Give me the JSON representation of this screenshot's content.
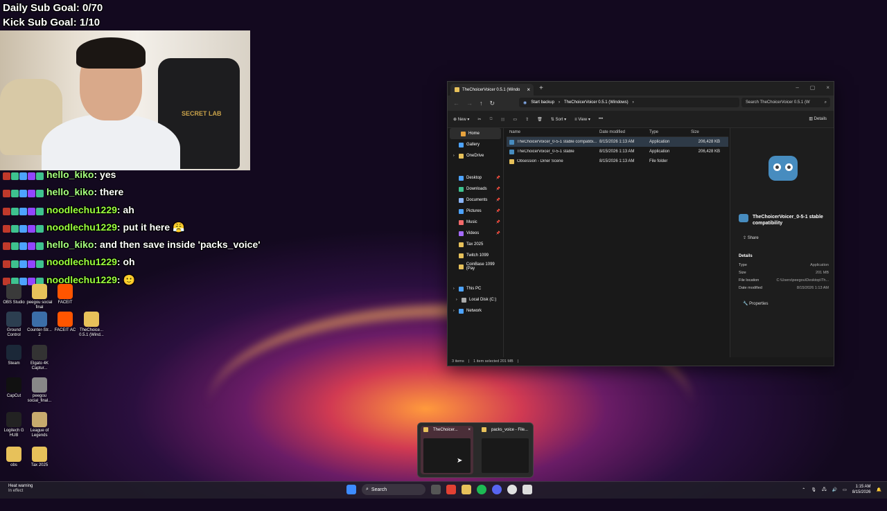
{
  "overlays": {
    "daily_goal": "Daily Sub Goal: 0/70",
    "kick_goal": "Kick Sub Goal: 1/10",
    "chair_logo": "SECRET LAB"
  },
  "chat": [
    {
      "user": "hello_kiko",
      "text": "yes"
    },
    {
      "user": "hello_kiko",
      "text": "there"
    },
    {
      "user": "noodlechu1229",
      "text": "ah"
    },
    {
      "user": "noodlechu1229",
      "text": "put it here 😤"
    },
    {
      "user": "hello_kiko",
      "text": "and then save inside 'packs_voice'"
    },
    {
      "user": "noodlechu1229",
      "text": "oh"
    },
    {
      "user": "noodlechu1229",
      "text": "🙂"
    }
  ],
  "desktop_icons": [
    {
      "label": "OBS Studio",
      "color": "#3a3a3a"
    },
    {
      "label": "peegou social final",
      "color": "#e7c15a"
    },
    {
      "label": "FACEIT",
      "color": "#ff5500"
    },
    {
      "label": "Ground Control",
      "color": "#2c3e50"
    },
    {
      "label": "Counter-Str... 2",
      "color": "#3b6ea8"
    },
    {
      "label": "FACEIT AC",
      "color": "#ff5500"
    },
    {
      "label": "TheChoice... 0.5.1 (Wind...",
      "color": "#e7c15a"
    },
    {
      "label": "Steam",
      "color": "#1b2838"
    },
    {
      "label": "Elgato 4K Captur...",
      "color": "#333333"
    },
    {
      "label": "CapCut",
      "color": "#111111"
    },
    {
      "label": "peegou social_final...",
      "color": "#888888"
    },
    {
      "label": "Logitech G HUB",
      "color": "#222222"
    },
    {
      "label": "League of Legends",
      "color": "#c8aa6e"
    },
    {
      "label": "obs",
      "color": "#e7c15a"
    },
    {
      "label": "Tax 2025",
      "color": "#e7c15a"
    }
  ],
  "explorer": {
    "tab_title": "TheChoicerVoicer 0.5.1 (Windo",
    "breadcrumb": [
      "Start backup",
      "TheChoicerVoicer 0.5.1 (Windows)"
    ],
    "search_placeholder": "Search TheChoicerVoicer 0.5.1 (W",
    "toolbar": {
      "new": "New",
      "sort": "Sort",
      "view": "View",
      "more": "•••",
      "details": "Details"
    },
    "nav": [
      {
        "label": "Home",
        "color": "#e8a33d",
        "selected": true
      },
      {
        "label": "Gallery",
        "color": "#4da3ff"
      },
      {
        "label": "OneDrive",
        "color": "#e7c15a",
        "expand": true
      },
      {
        "label": "",
        "color": "transparent"
      },
      {
        "label": "Desktop",
        "color": "#4da3ff",
        "pinned": true
      },
      {
        "label": "Downloads",
        "color": "#3ec28f",
        "pinned": true
      },
      {
        "label": "Documents",
        "color": "#8ab4f8",
        "pinned": true
      },
      {
        "label": "Pictures",
        "color": "#4da3ff",
        "pinned": true
      },
      {
        "label": "Music",
        "color": "#f46a6a",
        "pinned": true
      },
      {
        "label": "Videos",
        "color": "#a56bff",
        "pinned": true
      },
      {
        "label": "Tax 2025",
        "color": "#e7c15a"
      },
      {
        "label": "Twitch 1099",
        "color": "#e7c15a"
      },
      {
        "label": "CoinBase 1099 (Pay",
        "color": "#e7c15a"
      },
      {
        "label": "",
        "color": "transparent"
      },
      {
        "label": "This PC",
        "color": "#4da3ff",
        "expand": true
      },
      {
        "label": "Local Disk (C:)",
        "color": "#aaaaaa",
        "expand": true,
        "indent": true
      },
      {
        "label": "Network",
        "color": "#4da3ff",
        "expand": true
      }
    ],
    "columns": [
      "Name",
      "Date modified",
      "Type",
      "Size"
    ],
    "files": [
      {
        "name": "TheChoicerVoicer_0-5-1 stable compatibi...",
        "date": "8/15/2026 1:13 AM",
        "type": "Application",
        "size": "206,428 KB",
        "selected": true,
        "color": "#478cbf"
      },
      {
        "name": "TheChoicerVoicer_0-5-1 stable",
        "date": "8/15/2026 1:13 AM",
        "type": "Application",
        "size": "206,428 KB",
        "color": "#478cbf"
      },
      {
        "name": "Obsession - Diner Scene",
        "date": "8/15/2026 1:13 AM",
        "type": "File folder",
        "size": "",
        "color": "#e7c15a"
      }
    ],
    "pane": {
      "name": "TheChoicerVoicer_0-5-1 stable compatibility",
      "share": "Share",
      "details_title": "Details",
      "details": [
        {
          "k": "Type",
          "v": "Application"
        },
        {
          "k": "Size",
          "v": "201 MB"
        },
        {
          "k": "File location",
          "v": "C:\\Users\\peegou\\Desktop\\Th..."
        },
        {
          "k": "Date modified",
          "v": "8/15/2026 1:13 AM"
        }
      ],
      "properties": "Properties"
    },
    "status": [
      "3 items",
      "1 item selected  201 MB"
    ]
  },
  "thumbnails": [
    {
      "title": "TheChoicer...",
      "active": true
    },
    {
      "title": "packs_voice - File..."
    }
  ],
  "taskbar": {
    "weather_line1": "Heat warning",
    "weather_line2": "In effect",
    "search": "Search",
    "time": "1:15 AM",
    "date": "8/15/2026"
  }
}
